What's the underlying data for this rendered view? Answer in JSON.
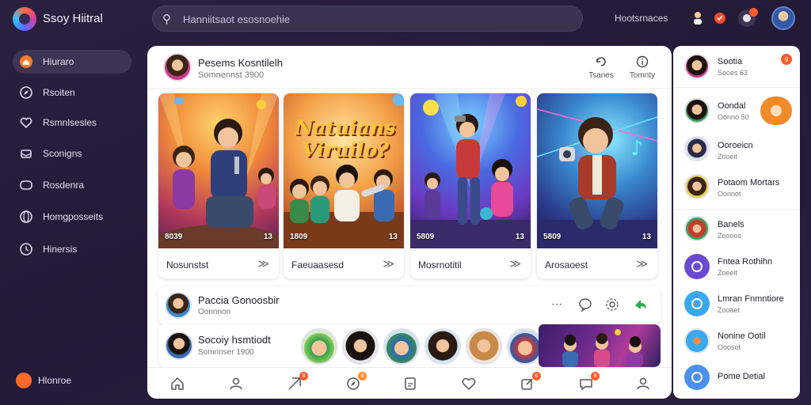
{
  "app": {
    "title": "Ssoy Hiitral"
  },
  "search": {
    "placeholder": "Hanniitsaot esosnoehie"
  },
  "topbar": {
    "link": "Hootsrnaces",
    "badge_1": "",
    "badge_2": ""
  },
  "sidebar": {
    "items": [
      {
        "label": "Hiuraro",
        "icon": "home-icon"
      },
      {
        "label": "Rsoiten",
        "icon": "compass-icon"
      },
      {
        "label": "Rsmnlsesles",
        "icon": "heart-icon"
      },
      {
        "label": "Sconigns",
        "icon": "inbox-icon"
      },
      {
        "label": "Rosdenra",
        "icon": "chat-icon"
      },
      {
        "label": "Homgposseits",
        "icon": "globe-icon"
      },
      {
        "label": "Hinersis",
        "icon": "clock-icon"
      }
    ],
    "bottom_label": "Hlonroe"
  },
  "main": {
    "header": {
      "name": "Pesems Kosntilelh",
      "sub": "Somnennst 3900",
      "actions": [
        {
          "label": "Tsanes",
          "icon": "share-icon"
        },
        {
          "label": "Tomnty",
          "icon": "info-icon"
        }
      ]
    },
    "cards": [
      {
        "title": "Nosunstst",
        "count_left": "8039",
        "count_right": "13"
      },
      {
        "title": "Faeuaasesd",
        "count_left": "1809",
        "count_right": "13",
        "art_text": "Natuians Viruilo?"
      },
      {
        "title": "Mosrnotitil",
        "count_left": "5809",
        "count_right": "13"
      },
      {
        "title": "Arosaoest",
        "count_left": "5809",
        "count_right": "13"
      }
    ],
    "row1": {
      "name": "Paccia Gonoosbir",
      "sub": "Oonnnon"
    },
    "row2": {
      "name": "Socoiy hsmtiodt",
      "sub": "Somnnser 1900"
    },
    "bottom_nav": {
      "badges": [
        "9",
        "6",
        "6",
        "9"
      ]
    }
  },
  "right_panel": {
    "badge": "9",
    "contacts": [
      {
        "name": "Sootia",
        "sub": "Sooes 63"
      },
      {
        "name": "Oondal",
        "sub": "Oonno 50"
      },
      {
        "name": "Ooroeicn",
        "sub": "Zooeit"
      },
      {
        "name": "Potaom Mortars",
        "sub": "Oonnot"
      },
      {
        "name": "Banels",
        "sub": "Zoooos"
      },
      {
        "name": "Fntea Rothihn",
        "sub": "Zoeeit"
      },
      {
        "name": "Lmran Fnmntiore",
        "sub": "Zooaet"
      },
      {
        "name": "Nonine Ootil",
        "sub": "Ooosot"
      },
      {
        "name": "Pome Detial",
        "sub": ""
      }
    ]
  },
  "colors": {
    "background": "#2a2140",
    "accent": "#ff5a2a",
    "orange": "#f28a2a",
    "purple": "#6a4ad0",
    "blue": "#3aa8f0"
  }
}
